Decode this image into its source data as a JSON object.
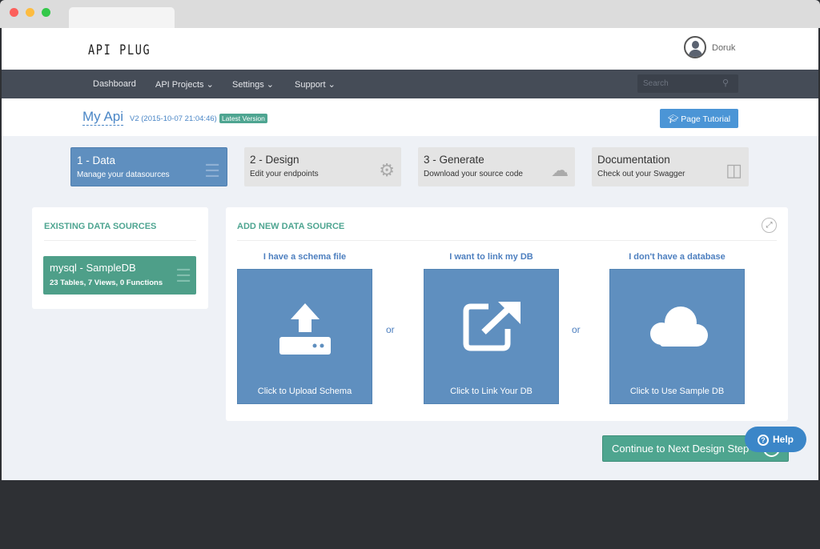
{
  "header": {
    "logo": "API PLUG",
    "user": "Doruk"
  },
  "nav": {
    "items": [
      "Dashboard",
      "API Projects ⌄",
      "Settings ⌄",
      "Support ⌄"
    ],
    "search_placeholder": "Search"
  },
  "project": {
    "name": "My Api",
    "version": "V2 (2015-10-07 21:04:46)",
    "badge": "Latest Version",
    "tutorial": "Page Tutorial"
  },
  "steps": [
    {
      "title": "1 - Data",
      "desc": "Manage your datasources"
    },
    {
      "title": "2 - Design",
      "desc": "Edit your endpoints"
    },
    {
      "title": "3 - Generate",
      "desc": "Download your source code"
    },
    {
      "title": "Documentation",
      "desc": "Check out your Swagger"
    }
  ],
  "existing": {
    "title": "EXISTING DATA SOURCES",
    "source": {
      "name": "mysql - SampleDB",
      "detail": "23 Tables, 7 Views, 0 Functions"
    }
  },
  "add": {
    "title": "ADD NEW DATA SOURCE",
    "or": "or",
    "options": [
      {
        "heading": "I have a schema file",
        "label": "Click to Upload Schema"
      },
      {
        "heading": "I want to link my DB",
        "label": "Click to Link Your DB"
      },
      {
        "heading": "I don't have a database",
        "label": "Click to Use Sample DB"
      }
    ]
  },
  "continue": "Continue to Next Design Step",
  "help": "Help"
}
